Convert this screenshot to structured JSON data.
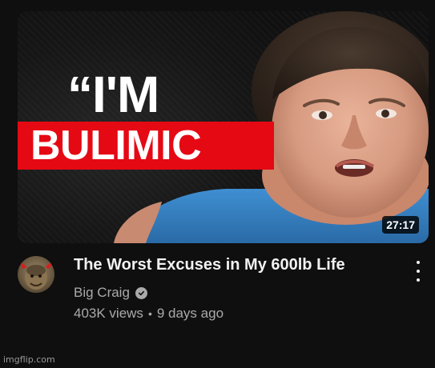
{
  "thumbnail": {
    "line1": "“I'M",
    "line2": "BULIMIC",
    "duration": "27:17",
    "banner_color": "#e50914"
  },
  "video": {
    "title": "The Worst Excuses in My 600lb Life",
    "channel": "Big Craig",
    "verified_icon": "verified-check-icon",
    "views": "403K views",
    "separator": "•",
    "age": "9 days ago"
  },
  "menu_icon": "more-vert-icon",
  "watermark": "imgflip.com"
}
